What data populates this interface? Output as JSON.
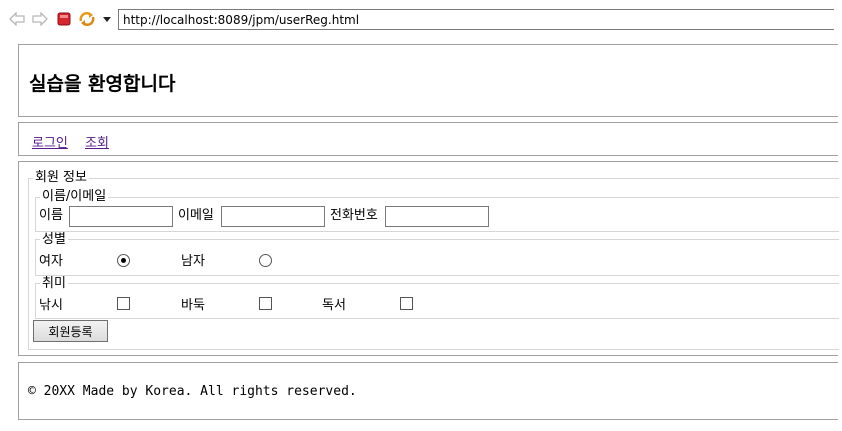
{
  "browser": {
    "url": "http://localhost:8089/jpm/userReg.html"
  },
  "header": {
    "title": "실습을 환영합니다"
  },
  "nav": {
    "links": [
      "로그인",
      "조회"
    ]
  },
  "form": {
    "legend": "회원 정보",
    "name_email": {
      "legend": "이름/이메일",
      "name_label": "이름",
      "email_label": "이메일",
      "phone_label": "전화번호",
      "name_value": "",
      "email_value": "",
      "phone_value": ""
    },
    "gender": {
      "legend": "성별",
      "options": [
        "여자",
        "남자"
      ],
      "selected": "여자"
    },
    "hobby": {
      "legend": "취미",
      "options": [
        "낚시",
        "바둑",
        "독서"
      ],
      "checked": []
    },
    "submit_label": "회원등록"
  },
  "footer": {
    "text": "© 20XX Made by Korea. All rights reserved."
  }
}
